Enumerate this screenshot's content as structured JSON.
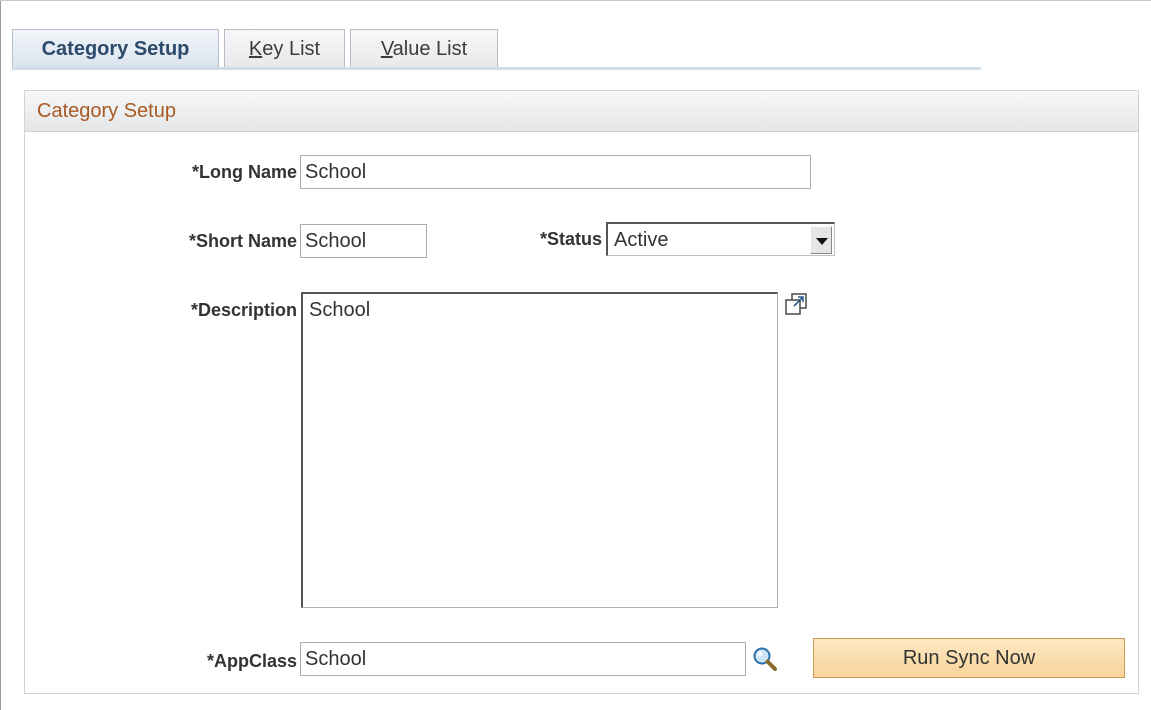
{
  "tabs": [
    {
      "label": "Category Setup",
      "active": true
    },
    {
      "label_underlined": "K",
      "label_rest": "ey List",
      "active": false
    },
    {
      "label_underlined": "V",
      "label_rest": "alue List",
      "active": false
    }
  ],
  "group": {
    "title": "Category Setup"
  },
  "form": {
    "long_name_label": "*Long Name",
    "long_name_value": "School",
    "short_name_label": "*Short Name",
    "short_name_value": "School",
    "status_label": "*Status",
    "status_value": "Active",
    "description_label": "*Description",
    "description_value": "School",
    "appclass_label": "*AppClass",
    "appclass_value": "School",
    "run_sync_label": "Run Sync Now"
  },
  "icons": {
    "expand": "expand-popup-icon",
    "lookup": "magnifier-icon"
  },
  "colors": {
    "group_title": "#a85a23",
    "active_tab_text": "#2c4a6b",
    "button_fill": "#f7d49a"
  }
}
